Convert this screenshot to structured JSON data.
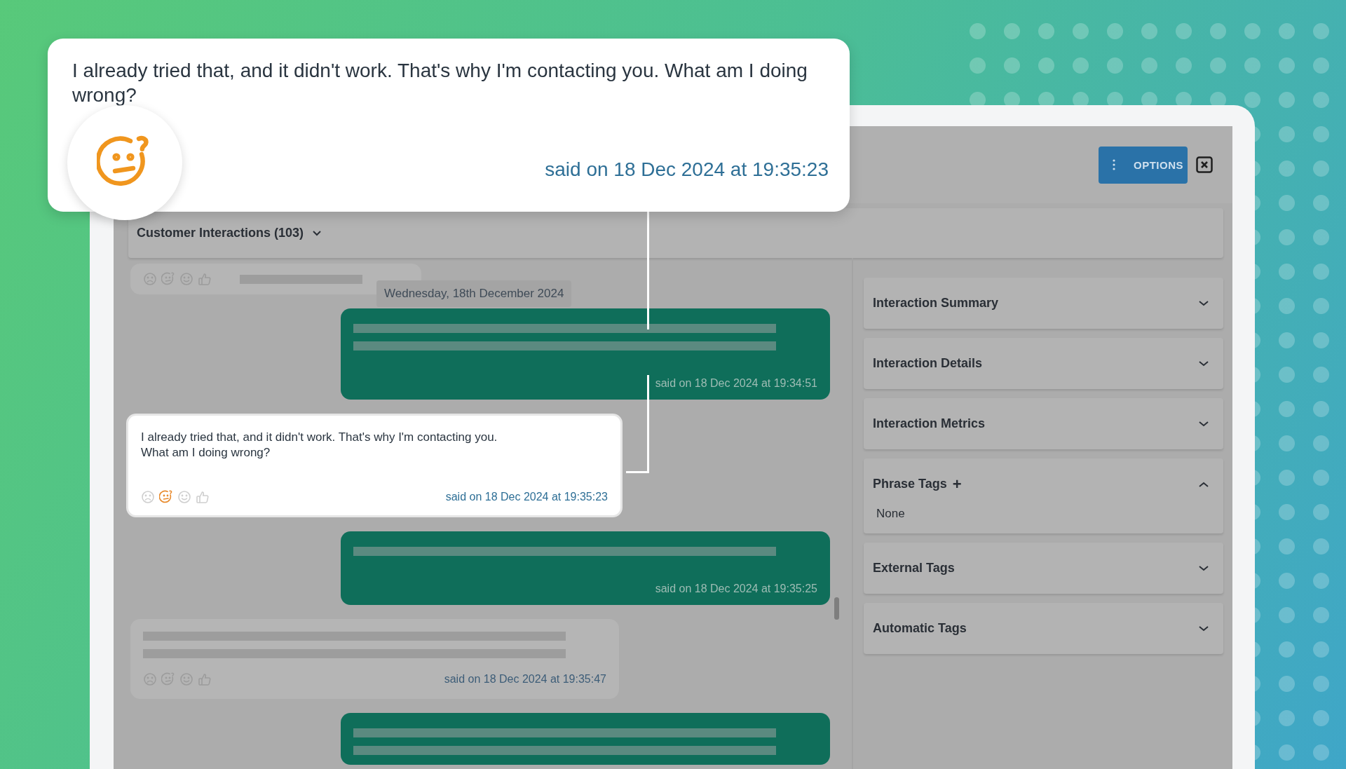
{
  "callout": {
    "text": "I already tried that, and it didn't work. That's why I'm contacting you. What am I doing wrong?",
    "said": "said on 18 Dec 2024 at 19:35:23"
  },
  "header": {
    "options_button": "OPTIONS"
  },
  "interactions_bar": {
    "label": "Customer Interactions (103)"
  },
  "chat": {
    "date_chip": "Wednesday, 18th December 2024",
    "messages": [
      {
        "kind": "customer-partial",
        "reactions": [
          {
            "kind": "frown",
            "selected": false
          },
          {
            "kind": "confused",
            "selected": false
          },
          {
            "kind": "smile",
            "selected": false
          },
          {
            "kind": "thumbs-up",
            "selected": false
          }
        ]
      },
      {
        "kind": "agent",
        "said": "said on 18 Dec 2024 at 19:34:51"
      },
      {
        "kind": "customer",
        "highlighted": true,
        "text": "I already tried that, and it didn't work. That's why I'm contacting you.\nWhat am I doing wrong?",
        "said": "said on 18 Dec 2024 at 19:35:23",
        "reactions": [
          {
            "kind": "frown",
            "selected": false
          },
          {
            "kind": "confused",
            "selected": true
          },
          {
            "kind": "smile",
            "selected": false
          },
          {
            "kind": "thumbs-up",
            "selected": false
          }
        ]
      },
      {
        "kind": "agent-single",
        "said": "said on 18 Dec 2024 at 19:35:25"
      },
      {
        "kind": "customer",
        "highlighted": false,
        "said": "said on 18 Dec 2024 at 19:35:47",
        "reactions": [
          {
            "kind": "frown",
            "selected": false
          },
          {
            "kind": "confused",
            "selected": false
          },
          {
            "kind": "smile",
            "selected": false
          },
          {
            "kind": "thumbs-up",
            "selected": false
          }
        ]
      },
      {
        "kind": "agent"
      }
    ]
  },
  "side_panel": {
    "sections": [
      {
        "title": "Interaction Summary",
        "expanded": false
      },
      {
        "title": "Interaction Details",
        "expanded": false
      },
      {
        "title": "Interaction Metrics",
        "expanded": false
      },
      {
        "title": "Phrase Tags",
        "add_label": "+",
        "expanded": true,
        "content": "None"
      },
      {
        "title": "External Tags",
        "expanded": false
      },
      {
        "title": "Automatic Tags",
        "expanded": false
      }
    ]
  }
}
